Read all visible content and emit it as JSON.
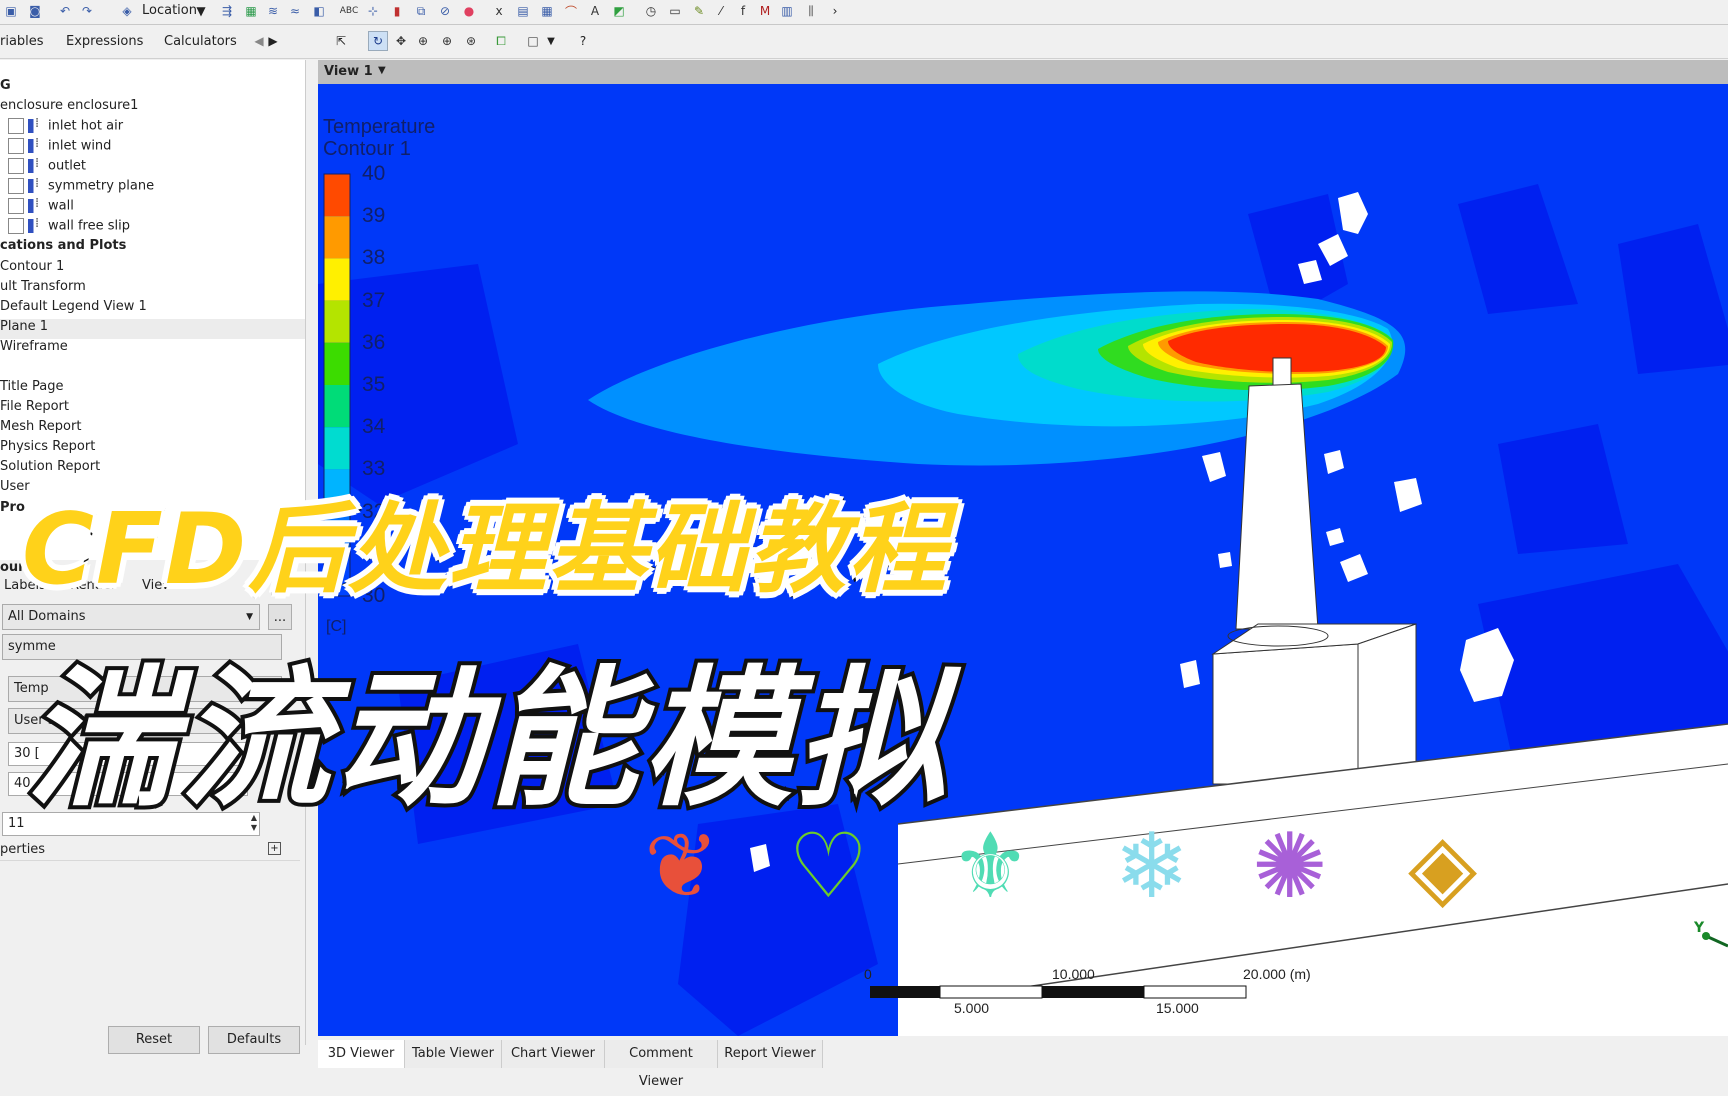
{
  "toolbar": {
    "location_label": "Location",
    "icons": [
      "save-icon",
      "snapshot-icon",
      "undo-icon",
      "redo-icon",
      "location-icon",
      "vector-icon",
      "contour-icon",
      "streamline-icon",
      "particle-track-icon",
      "volume-rendering-icon",
      "text-icon",
      "coordinate-frame-icon",
      "legend-icon",
      "instance-transform-icon",
      "clip-plane-icon",
      "color-map-icon",
      "variable-icon",
      "expression-icon",
      "table-icon",
      "chart-icon",
      "comment-icon",
      "figure-icon",
      "time-step-icon",
      "animation-icon",
      "quick-edit-icon",
      "probe-icon",
      "function-calculator-icon",
      "macro-calculator-icon",
      "mesh-calculator-icon",
      "case-comparison-icon",
      "command-editor-icon"
    ]
  },
  "left_tabs": [
    "riables",
    "Expressions",
    "Calculators"
  ],
  "viewer_toolbar": {
    "icons": [
      "select-icon",
      "rotate-icon",
      "pan-icon",
      "zoom-icon",
      "zoom-in-icon",
      "zoom-box-icon",
      "fit-view-icon",
      "viewport-layout-icon",
      "help-icon"
    ]
  },
  "tree": {
    "root": "G",
    "domain": "enclosure enclosure1",
    "boundaries": [
      "inlet hot air",
      "inlet wind",
      "outlet",
      "symmetry plane",
      "wall",
      "wall free slip"
    ],
    "section_user": "cations and Plots",
    "plots": [
      "Contour 1",
      "ult Transform",
      "Default Legend View 1",
      "Plane 1",
      "Wireframe"
    ],
    "reports": [
      "Title Page",
      "File Report",
      "Mesh Report",
      "Physics Report",
      "Solution Report",
      "User"
    ],
    "selected": "Contour 1",
    "section_pro": "Pro"
  },
  "details": {
    "section_label": "our",
    "tabs": [
      "Labels",
      "Render",
      "View"
    ],
    "domains": "All Domains",
    "locations": "symme",
    "variable": "Temp",
    "range": "User Specif",
    "min": "30 [",
    "max": "40",
    "num_contours": "11",
    "properties_label": "perties",
    "reset_label": "Reset",
    "defaults_label": "Defaults",
    "ellipsis": "..."
  },
  "viewer": {
    "view_label": "View 1",
    "bottom_tabs": [
      "3D Viewer",
      "Table Viewer",
      "Chart Viewer",
      "Comment Viewer",
      "Report Viewer"
    ],
    "active_tab": "3D Viewer"
  },
  "legend": {
    "title": "Temperature",
    "subtitle": "Contour 1",
    "ticks": [
      "40",
      "39",
      "38",
      "37",
      "36",
      "35",
      "34",
      "33",
      "32",
      "31",
      "30"
    ],
    "unit": "[C]",
    "colors": [
      "#ff4a00",
      "#ff9a00",
      "#fff000",
      "#b4e400",
      "#3cdc00",
      "#00dc78",
      "#00dcd0",
      "#00b4ff",
      "#0070ff",
      "#0044ff"
    ]
  },
  "scale_bar": {
    "labels_top": [
      "0",
      "10.000",
      "20.000 (m)"
    ],
    "labels_bottom": [
      "5.000",
      "15.000"
    ]
  },
  "overlay": {
    "line1": "CFD后处理基础教程",
    "line2": "湍流动能模拟",
    "emblems": [
      "pyro-emblem-icon",
      "dendro-emblem-icon",
      "anemo-emblem-icon",
      "cryo-emblem-icon",
      "electro-emblem-icon",
      "geo-emblem-icon"
    ]
  },
  "axis": {
    "label": "Y"
  }
}
